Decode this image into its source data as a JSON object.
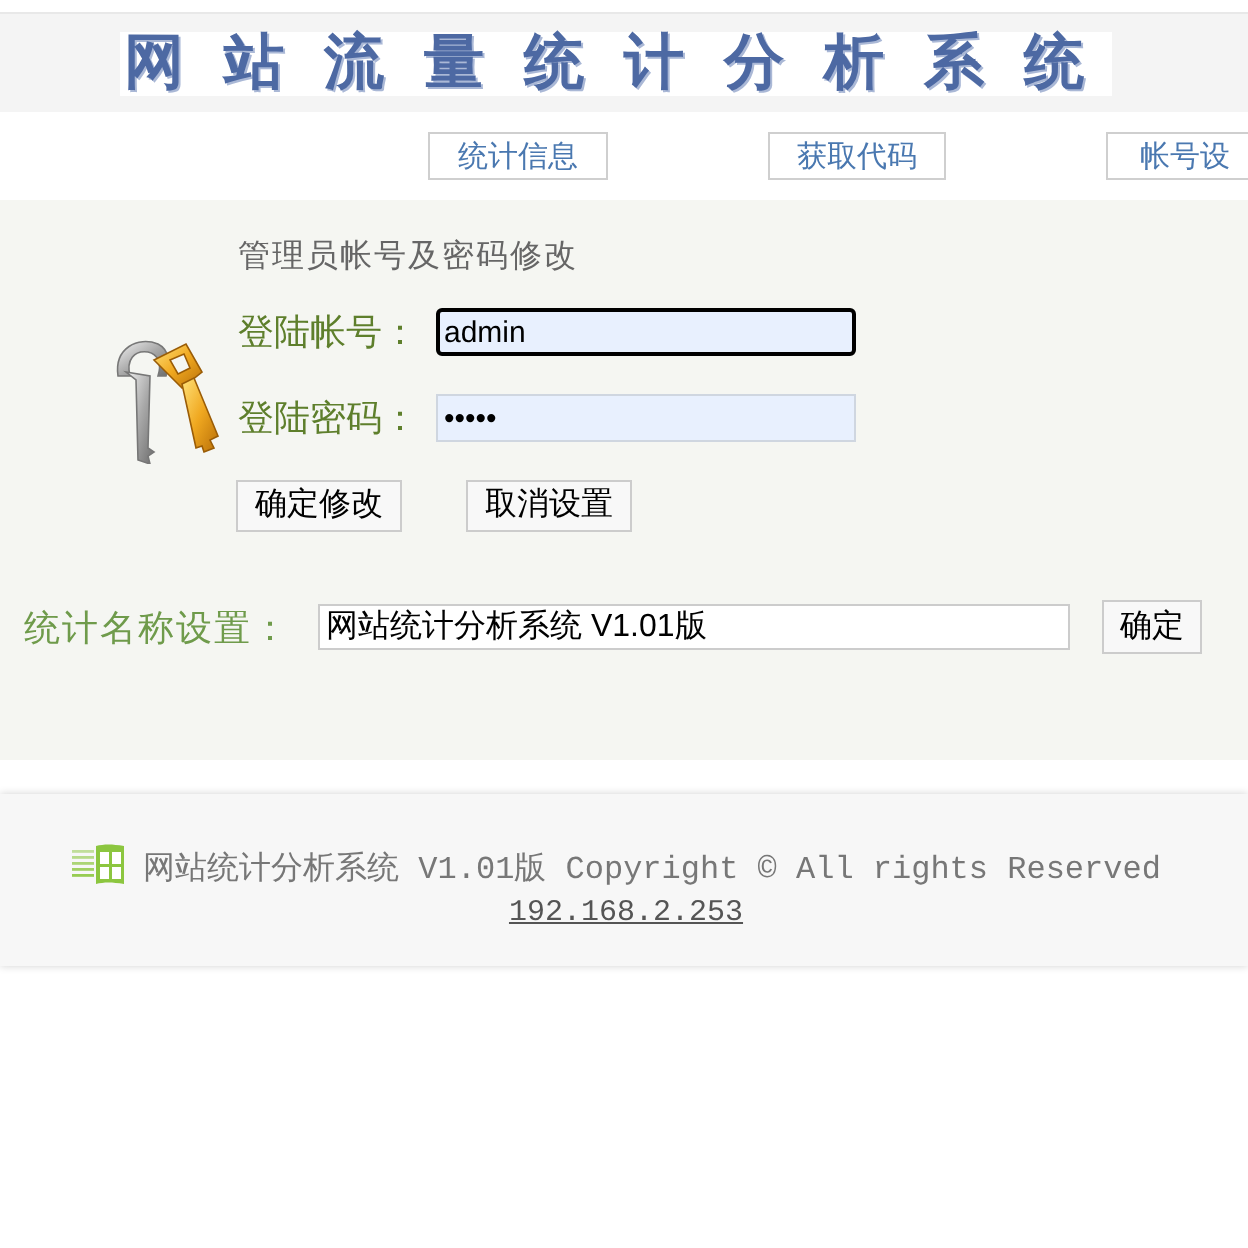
{
  "header": {
    "title": "网站流量统计分析系统"
  },
  "nav": [
    {
      "label": "统计信息"
    },
    {
      "label": "获取代码"
    },
    {
      "label": "帐号设"
    }
  ],
  "account_panel": {
    "heading": "管理员帐号及密码修改",
    "fields": [
      {
        "label": "登陆帐号：",
        "value": "admin",
        "focused": true
      },
      {
        "label": "登陆密码：",
        "value": "•••••",
        "focused": false
      }
    ],
    "buttons": [
      "确定修改",
      "取消设置"
    ]
  },
  "name_setting": {
    "label": "统计名称设置：",
    "value": "网站统计分析系统 V1.01版",
    "button": "确定"
  },
  "footer": {
    "text": "网站统计分析系统 V1.01版 Copyright © All rights Reserved",
    "link": "192.168.2.253"
  }
}
